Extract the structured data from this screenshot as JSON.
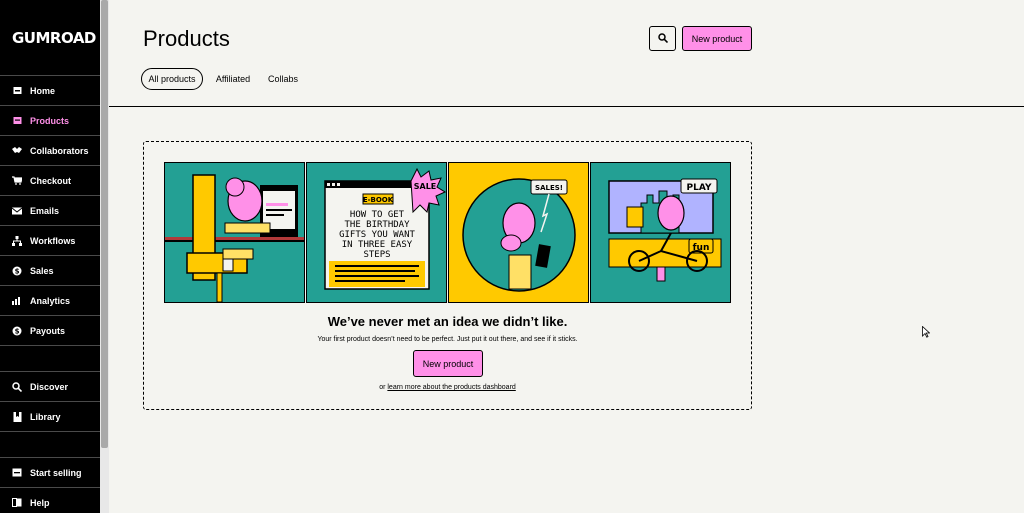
{
  "brand": {
    "logo_text": "GUMROAD"
  },
  "sidebar": {
    "items": [
      {
        "label": "Home",
        "icon": "home-icon"
      },
      {
        "label": "Products",
        "icon": "products-icon",
        "active": true
      },
      {
        "label": "Collaborators",
        "icon": "handshake-icon"
      },
      {
        "label": "Checkout",
        "icon": "cart-icon"
      },
      {
        "label": "Emails",
        "icon": "envelope-icon"
      },
      {
        "label": "Workflows",
        "icon": "workflow-icon"
      },
      {
        "label": "Sales",
        "icon": "dollar-icon"
      },
      {
        "label": "Analytics",
        "icon": "bar-chart-icon"
      },
      {
        "label": "Payouts",
        "icon": "payout-icon"
      },
      {
        "label": "Discover",
        "icon": "search-icon"
      },
      {
        "label": "Library",
        "icon": "bookmark-icon"
      },
      {
        "label": "Start selling",
        "icon": "shop-icon"
      },
      {
        "label": "Help",
        "icon": "help-book-icon"
      }
    ]
  },
  "header": {
    "title": "Products",
    "new_product_label": "New product",
    "tabs": [
      {
        "label": "All products",
        "active": true
      },
      {
        "label": "Affiliated"
      },
      {
        "label": "Collabs"
      }
    ]
  },
  "empty_state": {
    "title": "We’ve never met an idea we didn’t like.",
    "subtitle": "Your first product doesn’t need to be perfect. Just put it out there, and see if it sticks.",
    "cta_label": "New product",
    "learn_prefix": "or",
    "learn_link": "learn more about the products dashboard",
    "illustrations": {
      "ebook_tag": "E-BOOK",
      "ebook_text": [
        "HOW TO GET",
        "THE BIRTHDAY",
        "GIFTS YOU WANT",
        "IN THREE EASY",
        "STEPS"
      ],
      "sale_badge": "SALE",
      "sales_bubble": "SALES!",
      "play_bubble": "PLAY",
      "fun_sign": "fun"
    }
  },
  "colors": {
    "accent": "#ff90e8",
    "teal": "#23a094",
    "yellow": "#ffc900",
    "background": "#f4f4f0",
    "sidebar": "#000000"
  }
}
